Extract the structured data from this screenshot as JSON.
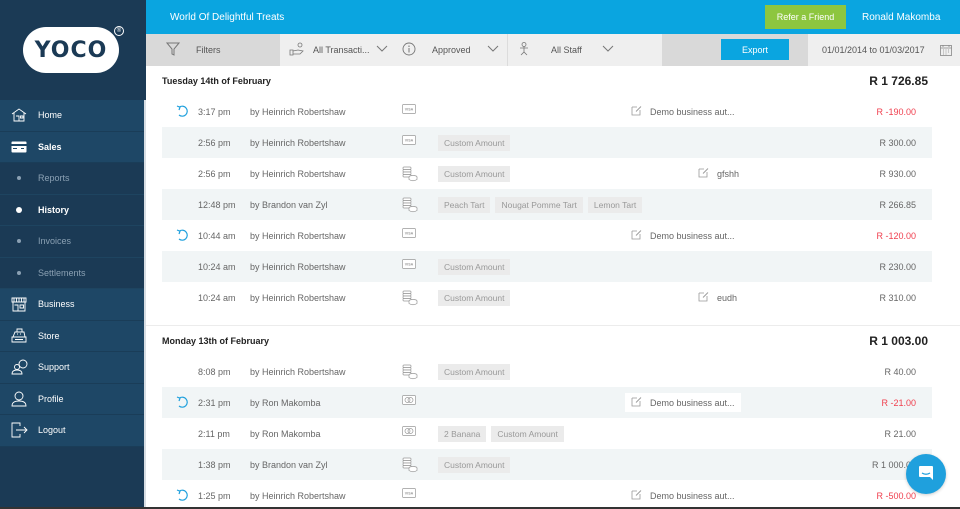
{
  "app": {
    "logo_text": "YOCO",
    "logo_reg": "®",
    "business_name": "World Of Delightful Treats",
    "refer_label": "Refer a Friend",
    "user_name": "Ronald Makomba"
  },
  "sidebar": {
    "items": [
      {
        "label": "Home",
        "icon": "home-icon",
        "type": "main"
      },
      {
        "label": "Sales",
        "icon": "card-icon",
        "type": "main",
        "active": true
      },
      {
        "label": "Reports",
        "type": "sub"
      },
      {
        "label": "History",
        "type": "sub",
        "active": true
      },
      {
        "label": "Invoices",
        "type": "sub"
      },
      {
        "label": "Settlements",
        "type": "sub"
      },
      {
        "label": "Business",
        "icon": "shop-icon",
        "type": "main"
      },
      {
        "label": "Store",
        "icon": "register-icon",
        "type": "main"
      },
      {
        "label": "Support",
        "icon": "support-icon",
        "type": "main"
      },
      {
        "label": "Profile",
        "icon": "profile-icon",
        "type": "main"
      },
      {
        "label": "Logout",
        "icon": "logout-icon",
        "type": "main"
      }
    ]
  },
  "filters": {
    "filters_label": "Filters",
    "transaction_type": "All Transacti...",
    "status": "Approved",
    "staff": "All Staff",
    "export_label": "Export",
    "date_range": "01/01/2014 to 01/03/2017"
  },
  "colors": {
    "accent": "#0aa5e0",
    "refer": "#8dc63f",
    "sidebar": "#1b3a55",
    "negative": "#f0404f"
  },
  "days": [
    {
      "title": "Tuesday 14th of February",
      "total": "R 1 726.85",
      "transactions": [
        {
          "refund": true,
          "time": "3:17 pm",
          "staff": "by Heinrich Robertshaw",
          "payment": "visa",
          "tags": [],
          "note": "Demo business aut...",
          "note_pos": "mid",
          "amount": "R -190.00",
          "negative": true
        },
        {
          "refund": false,
          "time": "2:56 pm",
          "staff": "by Heinrich Robertshaw",
          "payment": "visa",
          "tags": [
            "Custom Amount"
          ],
          "note": "",
          "amount": "R 300.00",
          "negative": false
        },
        {
          "refund": false,
          "time": "2:56 pm",
          "staff": "by Heinrich Robertshaw",
          "payment": "cash",
          "tags": [
            "Custom Amount"
          ],
          "note": "gfshh",
          "note_pos": "right",
          "amount": "R 930.00",
          "negative": false
        },
        {
          "refund": false,
          "time": "12:48 pm",
          "staff": "by Brandon van Zyl",
          "payment": "cash",
          "tags": [
            "Peach Tart",
            "Nougat Pomme Tart",
            "Lemon Tart"
          ],
          "note": "",
          "amount": "R 266.85",
          "negative": false
        },
        {
          "refund": true,
          "time": "10:44 am",
          "staff": "by Heinrich Robertshaw",
          "payment": "visa",
          "tags": [],
          "note": "Demo business aut...",
          "note_pos": "mid",
          "amount": "R -120.00",
          "negative": true
        },
        {
          "refund": false,
          "time": "10:24 am",
          "staff": "by Heinrich Robertshaw",
          "payment": "visa",
          "tags": [
            "Custom Amount"
          ],
          "note": "",
          "amount": "R 230.00",
          "negative": false
        },
        {
          "refund": false,
          "time": "10:24 am",
          "staff": "by Heinrich Robertshaw",
          "payment": "cash",
          "tags": [
            "Custom Amount"
          ],
          "note": "eudh",
          "note_pos": "right",
          "amount": "R 310.00",
          "negative": false
        }
      ]
    },
    {
      "title": "Monday 13th of February",
      "total": "R 1 003.00",
      "transactions": [
        {
          "refund": false,
          "time": "8:08 pm",
          "staff": "by Heinrich Robertshaw",
          "payment": "cash",
          "tags": [
            "Custom Amount"
          ],
          "note": "",
          "amount": "R 40.00",
          "negative": false
        },
        {
          "refund": true,
          "time": "2:31 pm",
          "staff": "by Ron Makomba",
          "payment": "mastercard",
          "tags": [],
          "note": "Demo business aut...",
          "note_pos": "mid",
          "note_boxed": true,
          "amount": "R -21.00",
          "negative": true
        },
        {
          "refund": false,
          "time": "2:11 pm",
          "staff": "by Ron Makomba",
          "payment": "mastercard",
          "tags": [
            "2  Banana",
            "Custom Amount"
          ],
          "note": "",
          "amount": "R 21.00",
          "negative": false
        },
        {
          "refund": false,
          "time": "1:38 pm",
          "staff": "by Brandon van Zyl",
          "payment": "cash",
          "tags": [
            "Custom Amount"
          ],
          "note": "",
          "amount": "R 1 000.00",
          "negative": false
        },
        {
          "refund": true,
          "time": "1:25 pm",
          "staff": "by Heinrich Robertshaw",
          "payment": "visa",
          "tags": [],
          "note": "Demo business aut...",
          "note_pos": "mid",
          "amount": "R -500.00",
          "negative": true
        }
      ]
    }
  ]
}
